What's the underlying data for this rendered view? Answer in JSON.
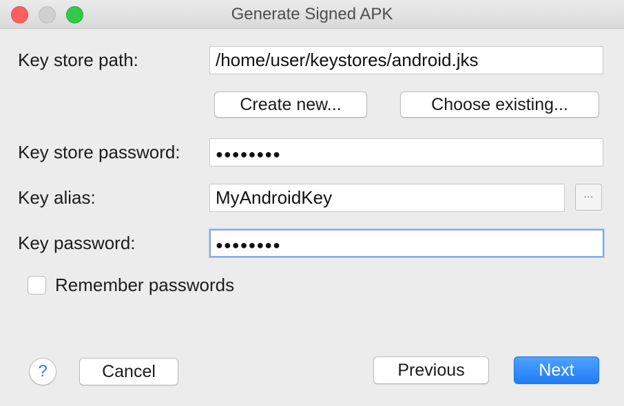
{
  "window": {
    "title": "Generate Signed APK"
  },
  "form": {
    "key_store_path": {
      "label": "Key store path:",
      "value": "/home/user/keystores/android.jks"
    },
    "create_new_label": "Create new...",
    "choose_existing_label": "Choose existing...",
    "key_store_password": {
      "label": "Key store password:",
      "value": "●●●●●●●●"
    },
    "key_alias": {
      "label": "Key alias:",
      "value": "MyAndroidKey",
      "browse_label": "···"
    },
    "key_password": {
      "label": "Key password:",
      "value": "●●●●●●●●"
    },
    "remember_passwords": {
      "label": "Remember passwords",
      "checked": false
    }
  },
  "footer": {
    "help_label": "?",
    "cancel_label": "Cancel",
    "previous_label": "Previous",
    "next_label": "Next"
  },
  "colors": {
    "primary_button": "#1f7cf5",
    "focus_ring": "#7fa9e3",
    "close": "#fc605c",
    "zoom": "#34c84a"
  }
}
